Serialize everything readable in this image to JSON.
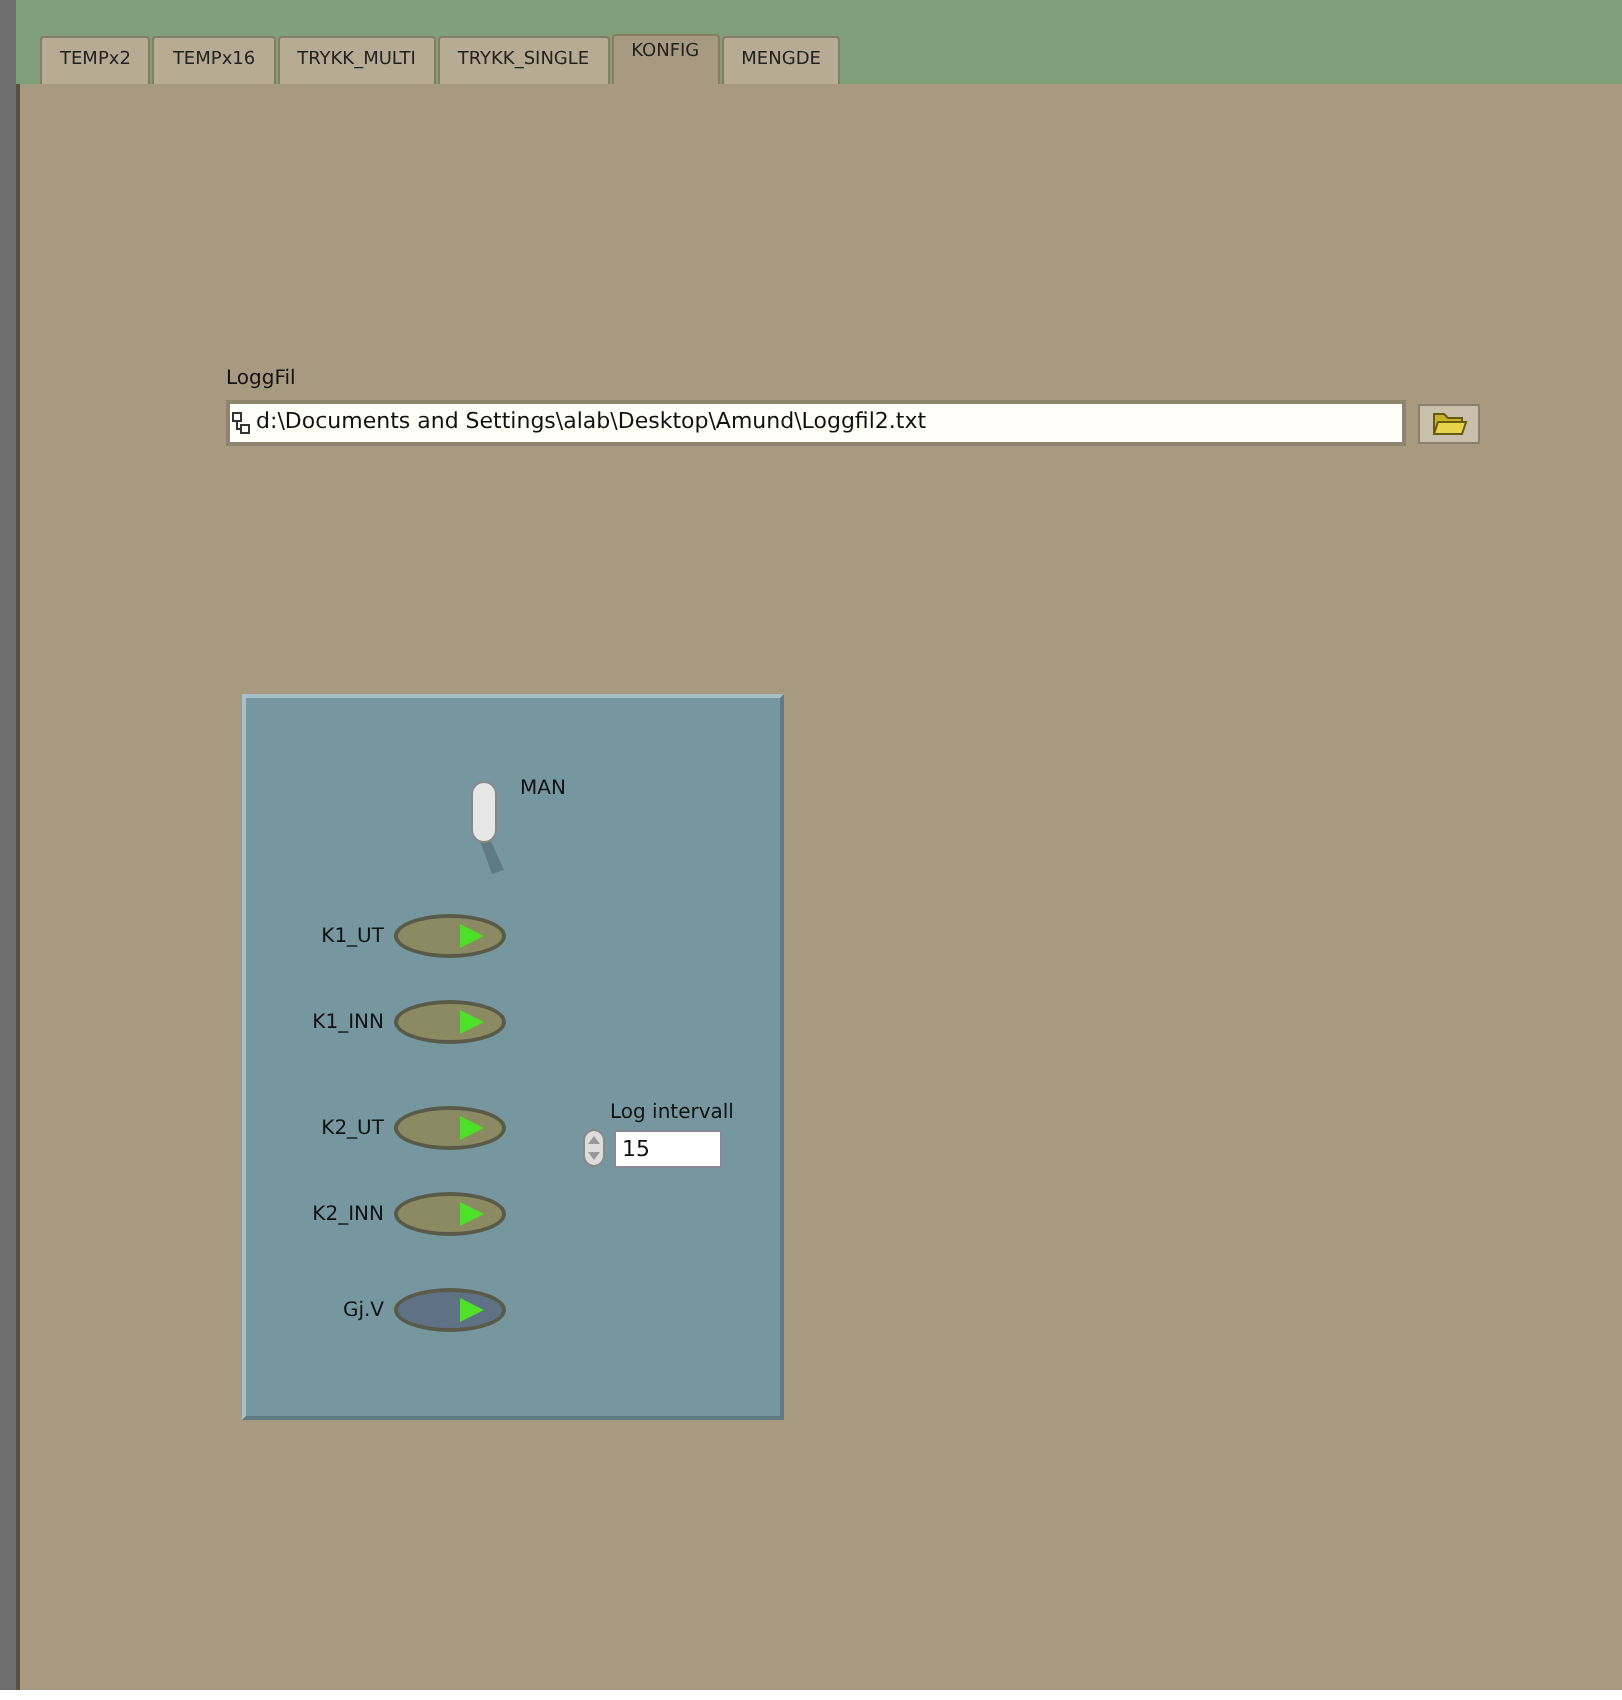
{
  "tabs": [
    {
      "label": "TEMPx2",
      "selected": false
    },
    {
      "label": "TEMPx16",
      "selected": false
    },
    {
      "label": "TRYKK_MULTI",
      "selected": false
    },
    {
      "label": "TRYKK_SINGLE",
      "selected": false
    },
    {
      "label": "KONFIG",
      "selected": true
    },
    {
      "label": "MENGDE",
      "selected": false
    }
  ],
  "log_file": {
    "label": "LoggFil",
    "value": "d:\\Documents and Settings\\alab\\Desktop\\Amund\\Loggfil2.txt"
  },
  "toggle": {
    "label": "MAN",
    "on": true
  },
  "switches": [
    {
      "label": "K1_UT",
      "on": true,
      "color": "#8c8a62"
    },
    {
      "label": "K1_INN",
      "on": true,
      "color": "#8c8a62"
    },
    {
      "label": "K2_UT",
      "on": true,
      "color": "#8c8a62"
    },
    {
      "label": "K2_INN",
      "on": true,
      "color": "#8c8a62"
    },
    {
      "label": "Gj.V",
      "on": true,
      "color": "#5f7184"
    }
  ],
  "log_interval": {
    "label": "Log intervall",
    "value": "15"
  }
}
